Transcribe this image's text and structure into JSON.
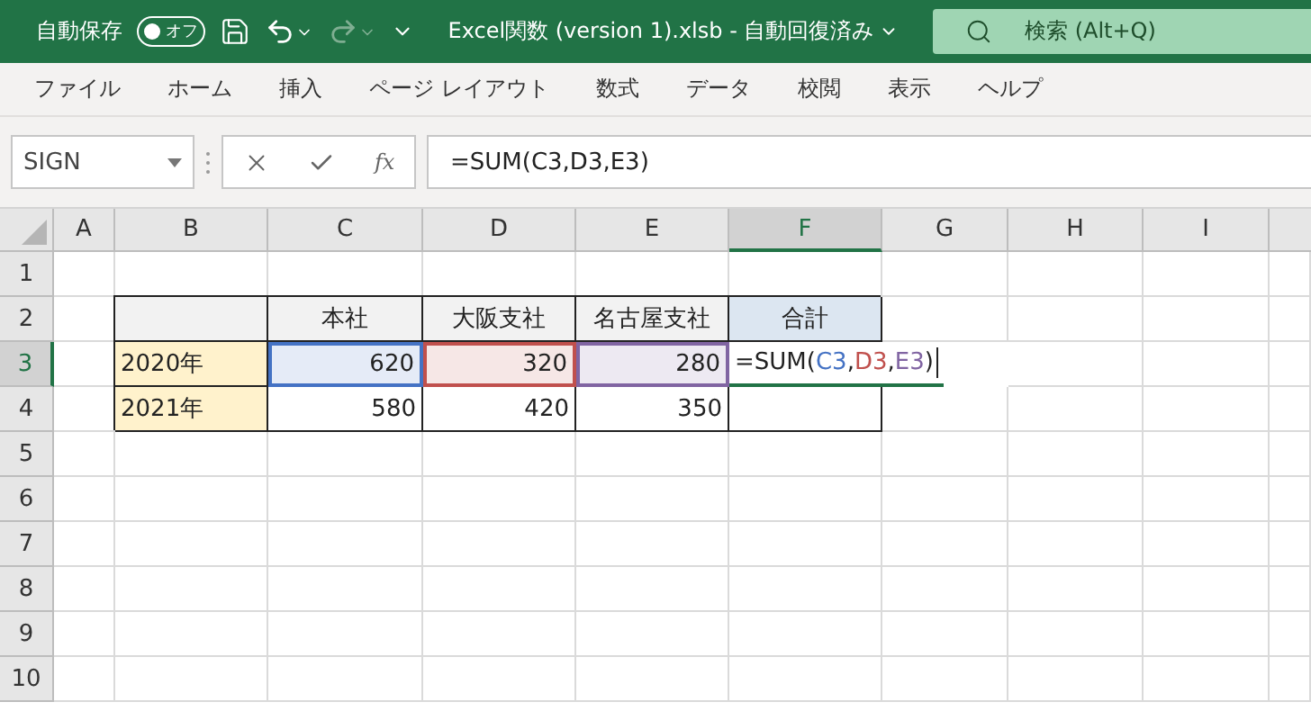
{
  "titlebar": {
    "autosave": {
      "label": "自動保存",
      "on": false,
      "state_label": "オフ"
    },
    "redo_disabled": true,
    "title": "Excel関数 (version 1).xlsb  -  自動回復済み",
    "search": {
      "placeholder": "検索 (Alt+Q)"
    }
  },
  "menu": [
    "ファイル",
    "ホーム",
    "挿入",
    "ページ レイアウト",
    "数式",
    "データ",
    "校閲",
    "表示",
    "ヘルプ"
  ],
  "formula_bar": {
    "name_box": "SIGN",
    "function_button": "fx",
    "formula": "=SUM(C3,D3,E3)"
  },
  "columns": [
    {
      "label": "A",
      "selected": false
    },
    {
      "label": "B",
      "selected": false
    },
    {
      "label": "C",
      "selected": false
    },
    {
      "label": "D",
      "selected": false
    },
    {
      "label": "E",
      "selected": false
    },
    {
      "label": "F",
      "selected": true
    },
    {
      "label": "G",
      "selected": false
    },
    {
      "label": "H",
      "selected": false
    },
    {
      "label": "I",
      "selected": false
    }
  ],
  "rows": [
    {
      "label": "1",
      "selected": false,
      "cells": [
        null,
        null,
        null,
        null,
        null,
        null,
        null,
        null,
        null
      ]
    },
    {
      "label": "2",
      "selected": false,
      "cells": [
        null,
        {
          "kind": "header"
        },
        {
          "kind": "header",
          "text": "本社"
        },
        {
          "kind": "header",
          "text": "大阪支社"
        },
        {
          "kind": "header",
          "text": "名古屋支社"
        },
        {
          "kind": "total-header",
          "text": "合計"
        },
        null,
        null,
        null
      ]
    },
    {
      "label": "3",
      "selected": true,
      "cells": [
        null,
        {
          "kind": "label",
          "text": "2020年"
        },
        {
          "kind": "number",
          "text": "620",
          "color": "#4472c4"
        },
        {
          "kind": "number",
          "text": "320",
          "color": "#c0504d"
        },
        {
          "kind": "number",
          "text": "280",
          "color": "#8064a2"
        },
        {
          "kind": "editing",
          "prefix": "=SUM(",
          "refs": [
            {
              "text": "C3",
              "color": "#4472c4",
              "after": ","
            },
            {
              "text": "D3",
              "color": "#c0504d",
              "after": ","
            },
            {
              "text": "E3",
              "color": "#8064a2",
              "after": ")"
            }
          ]
        },
        null,
        null,
        null
      ]
    },
    {
      "label": "4",
      "selected": false,
      "cells": [
        null,
        {
          "kind": "label",
          "text": "2021年"
        },
        {
          "kind": "number",
          "text": "580"
        },
        {
          "kind": "number",
          "text": "420"
        },
        {
          "kind": "number",
          "text": "350"
        },
        {
          "kind": "number"
        },
        null,
        null,
        null
      ]
    },
    {
      "label": "5",
      "selected": false,
      "cells": [
        null,
        null,
        null,
        null,
        null,
        null,
        null,
        null,
        null
      ]
    },
    {
      "label": "6",
      "selected": false,
      "cells": [
        null,
        null,
        null,
        null,
        null,
        null,
        null,
        null,
        null
      ]
    },
    {
      "label": "7",
      "selected": false,
      "cells": [
        null,
        null,
        null,
        null,
        null,
        null,
        null,
        null,
        null
      ]
    },
    {
      "label": "8",
      "selected": false,
      "cells": [
        null,
        null,
        null,
        null,
        null,
        null,
        null,
        null,
        null
      ]
    },
    {
      "label": "9",
      "selected": false,
      "cells": [
        null,
        null,
        null,
        null,
        null,
        null,
        null,
        null,
        null
      ]
    },
    {
      "label": "10",
      "selected": false,
      "cells": [
        null,
        null,
        null,
        null,
        null,
        null,
        null,
        null,
        null
      ]
    }
  ]
}
